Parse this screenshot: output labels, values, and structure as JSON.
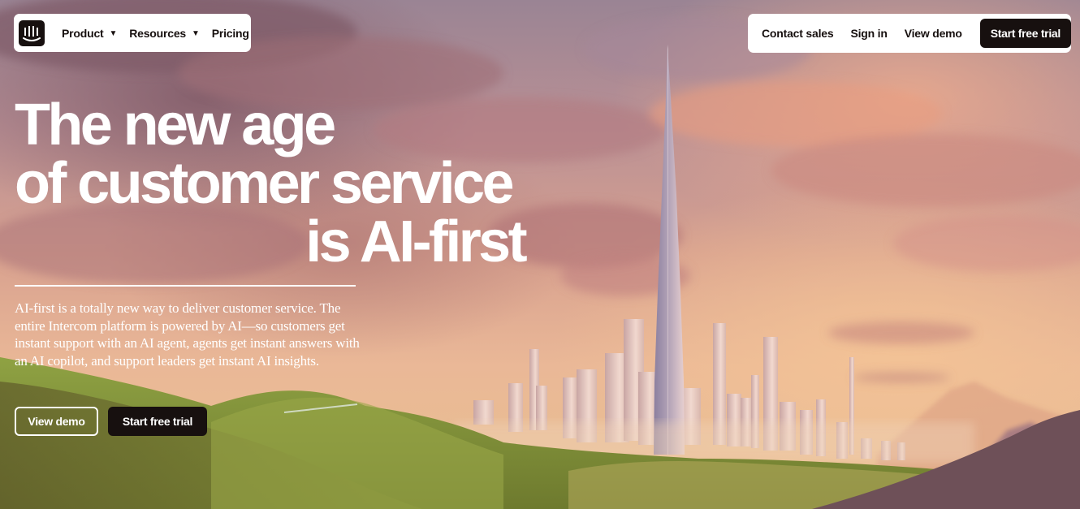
{
  "brand": {
    "name": "Intercom",
    "logo_icon": "intercom-logo-icon",
    "dark_color": "#17100f",
    "light_color": "#ffffff"
  },
  "nav_left": {
    "items": [
      {
        "label": "Product",
        "has_dropdown": true,
        "icon": "caret-down-icon"
      },
      {
        "label": "Resources",
        "has_dropdown": true,
        "icon": "caret-down-icon"
      },
      {
        "label": "Pricing",
        "has_dropdown": false
      }
    ],
    "caret_glyph": "▼"
  },
  "nav_right": {
    "contact_sales": "Contact sales",
    "sign_in": "Sign in",
    "view_demo": "View demo",
    "start_trial": "Start free trial"
  },
  "hero": {
    "headline_lines": [
      "The new age",
      "of customer service",
      "is AI-first"
    ],
    "description": "AI-first is a totally new way to deliver customer service. The entire Intercom platform is powered by AI—so customers get instant support with an AI agent, agents get instant answers with an AI copilot, and support leaders get instant AI insights.",
    "view_demo": "View demo",
    "start_trial": "Start free trial"
  },
  "background": {
    "description": "Painted sunset sky with pink clouds, tall spire skyscraper city skyline, green rolling hills",
    "sky_colors": [
      "#9a8494",
      "#d8a18f",
      "#eab897"
    ],
    "hill_color": "#8a9a3a"
  }
}
